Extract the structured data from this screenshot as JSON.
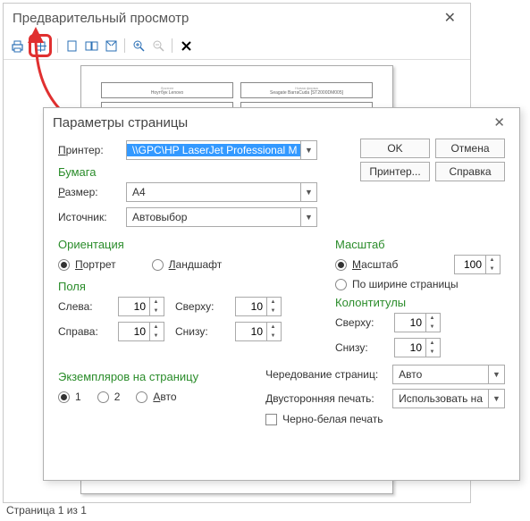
{
  "preview": {
    "title": "Предварительный просмотр",
    "status": "Страница 1 из 1",
    "paper": {
      "hdr1": "Листинг",
      "val1": "Ноутбук Lenovo",
      "hdr2": "Новая фирма",
      "val2": "Seagate BarraCuda [ST2000DM005]"
    }
  },
  "dialog": {
    "title": "Параметры страницы",
    "printer_lbl": "Принтер:",
    "printer_val": "\\\\GPC\\HP LaserJet Professional M",
    "buttons": {
      "ok": "OK",
      "cancel": "Отмена",
      "printer": "Принтер...",
      "help": "Справка"
    },
    "paper_section": "Бумага",
    "size_lbl": "Размер:",
    "size_val": "A4",
    "source_lbl": "Источник:",
    "source_val": "Автовыбор",
    "orientation_section": "Ориентация",
    "portrait": "Портрет",
    "landscape": "Ландшафт",
    "scale_section": "Масштаб",
    "scale_radio": "Масштаб",
    "scale_val": "100",
    "fit_radio": "По ширине страницы",
    "margins_section": "Поля",
    "left_lbl": "Слева:",
    "right_lbl": "Справа:",
    "top_lbl": "Сверху:",
    "bottom_lbl": "Снизу:",
    "margin_val": "10",
    "headers_section": "Колонтитулы",
    "copies_section": "Экземпляров на страницу",
    "copies_1": "1",
    "copies_2": "2",
    "copies_auto": "Авто",
    "alternation_lbl": "Чередование страниц:",
    "alternation_val": "Авто",
    "duplex_lbl": "Двусторонняя печать:",
    "duplex_val": "Использовать на",
    "bw_lbl": "Черно-белая печать"
  }
}
